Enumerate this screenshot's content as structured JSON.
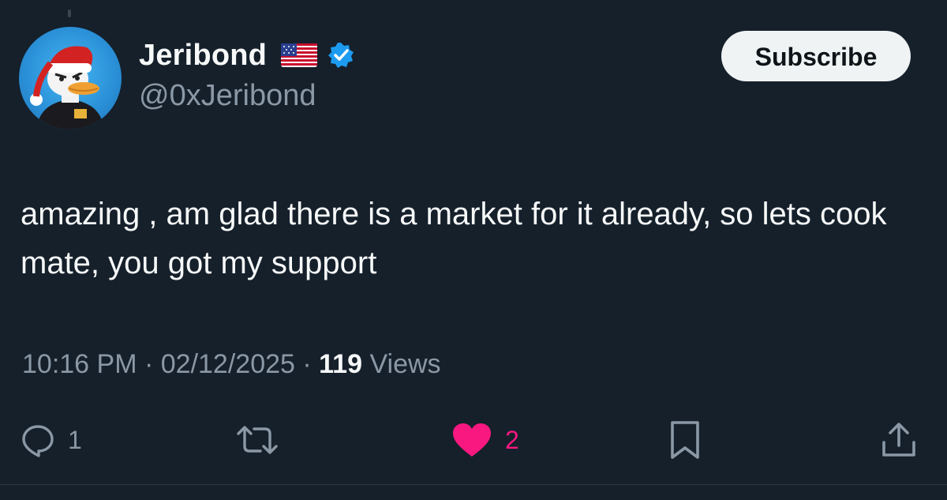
{
  "author": {
    "display_name": "Jeribond",
    "flag": "us-flag-emoji",
    "verified": true,
    "handle": "@0xJeribond",
    "avatar": "duck-in-santa-hat-avatar"
  },
  "header": {
    "subscribe_label": "Subscribe"
  },
  "tweet": {
    "text": "amazing , am glad there is a market for it already, so lets cook mate, you got my support"
  },
  "meta": {
    "time": "10:16 PM",
    "separator": " · ",
    "date": "02/12/2025",
    "views_count": "119",
    "views_label": " Views"
  },
  "actions": {
    "reply_count": "1",
    "retweet_count": "",
    "like_count": "2",
    "liked": true
  },
  "colors": {
    "background": "#15202b",
    "primary_text": "#f7f9f9",
    "secondary_text": "#8b98a5",
    "like_accent": "#f91880",
    "verified_blue": "#1d9bf0"
  }
}
